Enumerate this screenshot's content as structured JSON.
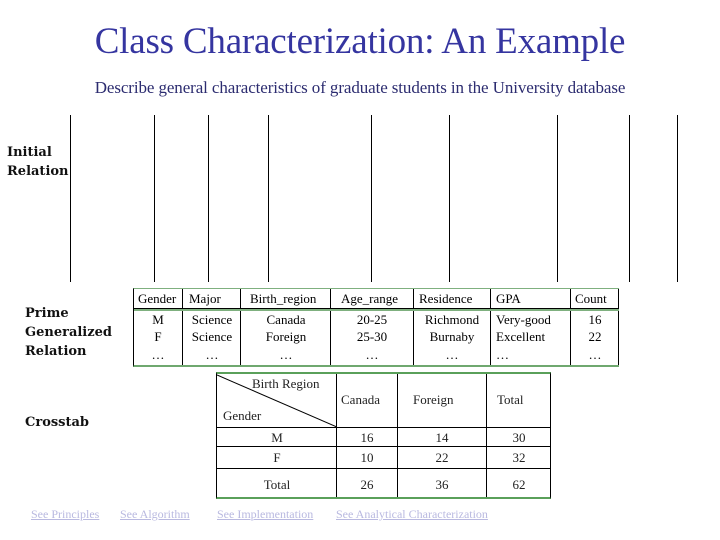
{
  "header": {
    "title": "Class Characterization: An Example",
    "subtitle": "Describe general characteristics of graduate students in the University database"
  },
  "labels": {
    "initial": [
      "Initial",
      "Relation"
    ],
    "prime": [
      "Prime",
      "Generalized",
      "Relation"
    ],
    "crosstab": "Crosstab"
  },
  "prime_table": {
    "columns": [
      "Gender",
      "Major",
      "Birth_region",
      "Age_range",
      "Residence",
      "GPA",
      "Count"
    ],
    "rows": [
      [
        "M",
        "Science",
        "Canada",
        "20-25",
        "Richmond",
        "Very-good",
        "16"
      ],
      [
        "F",
        "Science",
        "Foreign",
        "25-30",
        "Burnaby",
        "Excellent",
        "22"
      ],
      [
        "…",
        "…",
        "…",
        "…",
        "…",
        "…",
        "…"
      ]
    ]
  },
  "crosstab": {
    "corner_top": "Birth  Region",
    "corner_bottom": "Gender",
    "columns": [
      "Canada",
      "Foreign",
      "Total"
    ],
    "rows": [
      {
        "label": "M",
        "values": [
          "16",
          "14",
          "30"
        ]
      },
      {
        "label": "F",
        "values": [
          "10",
          "22",
          "32"
        ]
      },
      {
        "label": "Total",
        "values": [
          "26",
          "36",
          "62"
        ]
      }
    ]
  },
  "links": [
    "See Principles",
    "See Algorithm",
    "See Implementation",
    "See Analytical Characterization"
  ],
  "colors": {
    "title": "#3535a0",
    "subtitle": "#2c2c70",
    "link": "#b9b9e0",
    "table_accent": "#5aa05a"
  }
}
